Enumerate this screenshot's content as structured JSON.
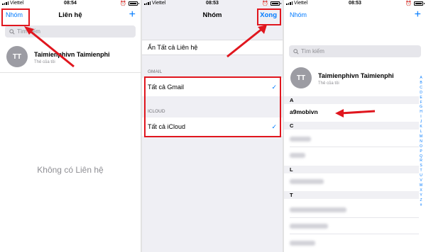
{
  "panel1": {
    "status": {
      "carrier": "Viettel",
      "time": "08:54"
    },
    "nav": {
      "left": "Nhóm",
      "title": "Liên hệ",
      "right": "+"
    },
    "search_placeholder": "Tìm kiếm",
    "me": {
      "initials": "TT",
      "name": "Taimienphivn Taimienphi",
      "subtitle": "Thẻ của tôi"
    },
    "empty_text": "Không có Liên hệ"
  },
  "panel2": {
    "status": {
      "carrier": "Viettel",
      "time": "08:53"
    },
    "nav": {
      "title": "Nhóm",
      "done": "Xong"
    },
    "hide_all": "Ẩn Tất cả Liên hệ",
    "gmail_header": "GMAIL",
    "all_gmail": "Tất cả Gmail",
    "icloud_header": "ICLOUD",
    "all_icloud": "Tất cả iCloud",
    "check": "✓"
  },
  "panel3": {
    "status": {
      "carrier": "Viettel",
      "time": "08:53"
    },
    "nav": {
      "left": "Nhóm",
      "right": "+"
    },
    "search_placeholder": "Tìm kiếm",
    "me": {
      "initials": "TT",
      "name": "Taimienphivn Taimienphi",
      "subtitle": "Thẻ của tôi"
    },
    "sections": {
      "a": "A",
      "c": "C",
      "l": "L",
      "t": "T"
    },
    "contact_a": "a9mobivn",
    "index_letters": "A B C D E F G H I J K L M N O P Q R S T U V W X Y Z #"
  },
  "colors": {
    "accent": "#007aff",
    "annotation": "#e0161e"
  },
  "icons": [
    "search-icon",
    "plus-icon",
    "checkmark-icon",
    "battery-icon",
    "signal-icon",
    "alarm-icon"
  ]
}
